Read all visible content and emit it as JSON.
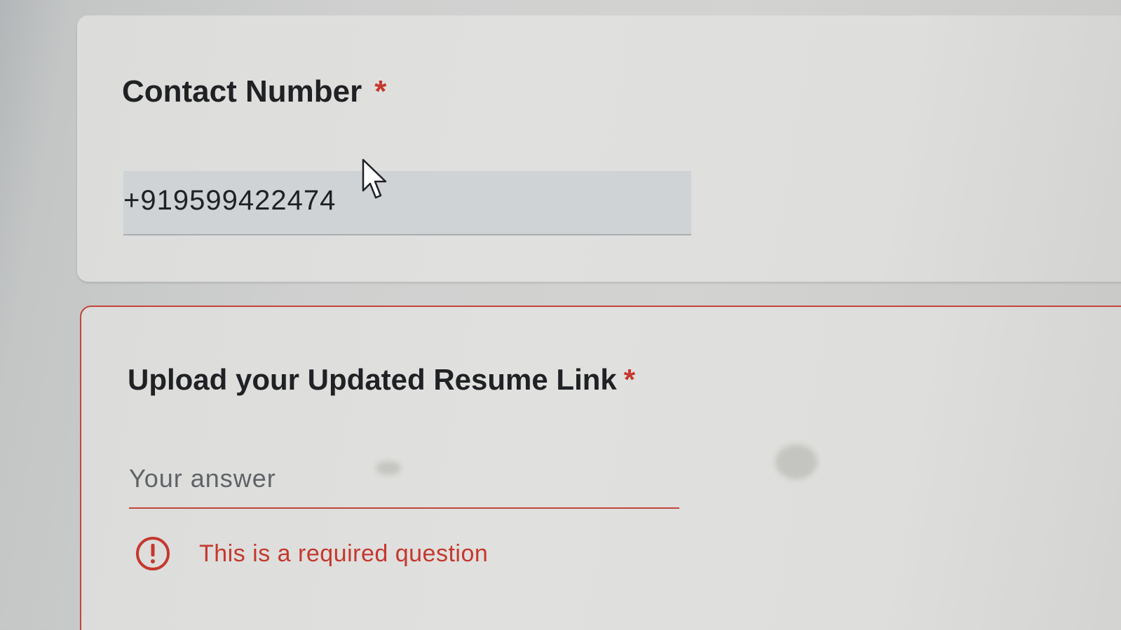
{
  "contact_question": {
    "title": "Contact Number",
    "required_marker": "*",
    "answer_value": "+919599422474"
  },
  "resume_question": {
    "title": "Upload your Updated Resume Link",
    "required_marker": "*",
    "input_placeholder": "Your answer",
    "error_message": "This is a required question",
    "error_icon": "error-exclamation-circle-icon"
  },
  "colors": {
    "error": "#c5382e",
    "text": "#202124",
    "input_fill": "#cfd3d6"
  }
}
